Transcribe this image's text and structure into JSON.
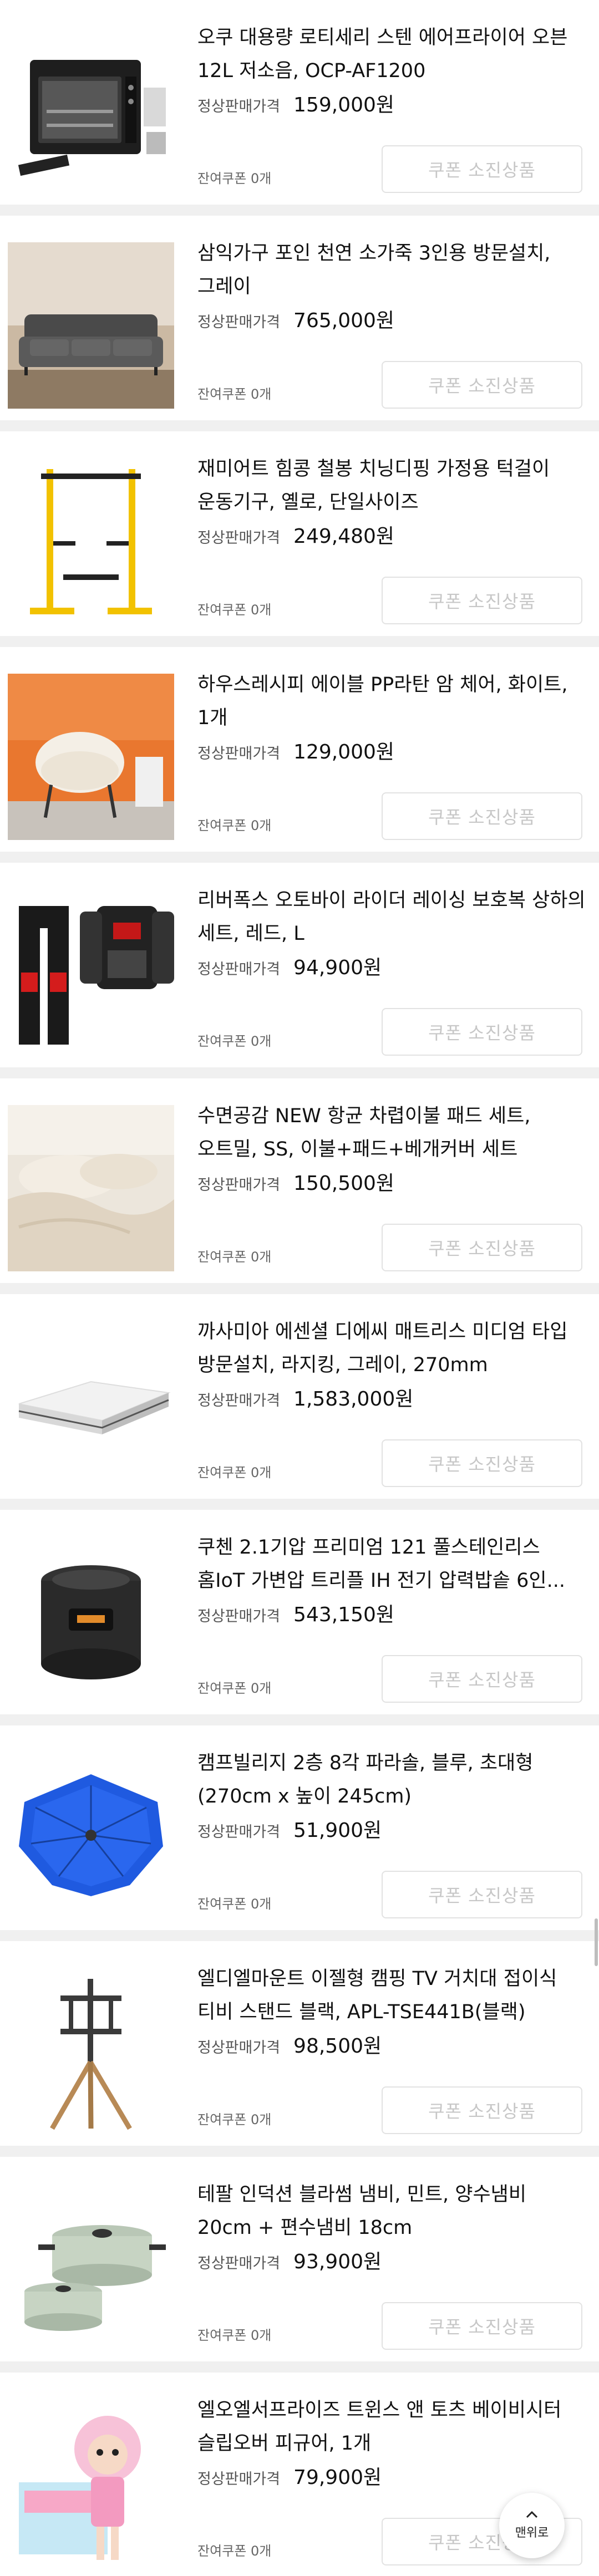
{
  "labels": {
    "regular_price": "정상판매가격",
    "coupons_left": "잔여쿠폰 0개",
    "coupon_exhausted": "쿠폰 소진상품",
    "back_to_top": "맨위로"
  },
  "colors": {
    "accent": "#3b78d8",
    "separator": "#f0f0f0",
    "disabled_text": "#c7c7c7"
  },
  "products": [
    {
      "title": "오쿠 대용량 로티세리 스텐 에어프라이어 오븐 12L 저소음, OCP-AF1200",
      "price": "159,000원",
      "image": "air-fryer-oven-image"
    },
    {
      "title": "삼익가구 포인 천연 소가죽 3인용 방문설치, 그레이",
      "price": "765,000원",
      "image": "leather-sofa-image"
    },
    {
      "title": "재미어트 힘콩 철봉 치닝디핑 가정용 턱걸이 운동기구, 옐로, 단일사이즈",
      "price": "249,480원",
      "image": "pull-up-bar-image"
    },
    {
      "title": "하우스레시피 에이블 PP라탄 암 체어, 화이트, 1개",
      "price": "129,000원",
      "image": "rattan-chair-image"
    },
    {
      "title": "리버폭스 오토바이 라이더 레이싱 보호복 상하의 세트, 레드, L",
      "price": "94,900원",
      "image": "motorcycle-protective-gear-image"
    },
    {
      "title": "수면공감 NEW 항균 차렵이불 패드 세트, 오트밀, SS, 이불+패드+베개커버 세트",
      "price": "150,500원",
      "image": "bedding-set-image"
    },
    {
      "title": "까사미아 에센셜 디에씨 매트리스 미디엄 타입 방문설치, 라지킹, 그레이, 270mm",
      "price": "1,583,000원",
      "image": "mattress-image"
    },
    {
      "title": "쿠첸 2.1기압 프리미엄 121 풀스테인리스 홈IoT 가변압 트리플 IH 전기 압력밥솥 6인...",
      "price": "543,150원",
      "image": "rice-cooker-image"
    },
    {
      "title": "캠프빌리지 2층 8각 파라솔, 블루, 초대형(270cm x 높이 245cm)",
      "price": "51,900원",
      "image": "parasol-image"
    },
    {
      "title": "엘디엘마운트 이젤형 캠핑 TV 거치대 접이식 티비 스탠드 블랙, APL-TSE441B(블랙)",
      "price": "98,500원",
      "image": "tv-stand-image"
    },
    {
      "title": "테팔 인덕션 블라썸 냄비, 민트, 양수냄비 20cm + 편수냄비 18cm",
      "price": "93,900원",
      "image": "cookware-pots-image"
    },
    {
      "title": "엘오엘서프라이즈 트윈스 앤 토츠 베이비시터 슬립오버 피규어, 1개",
      "price": "79,900원",
      "image": "doll-figure-image"
    }
  ]
}
